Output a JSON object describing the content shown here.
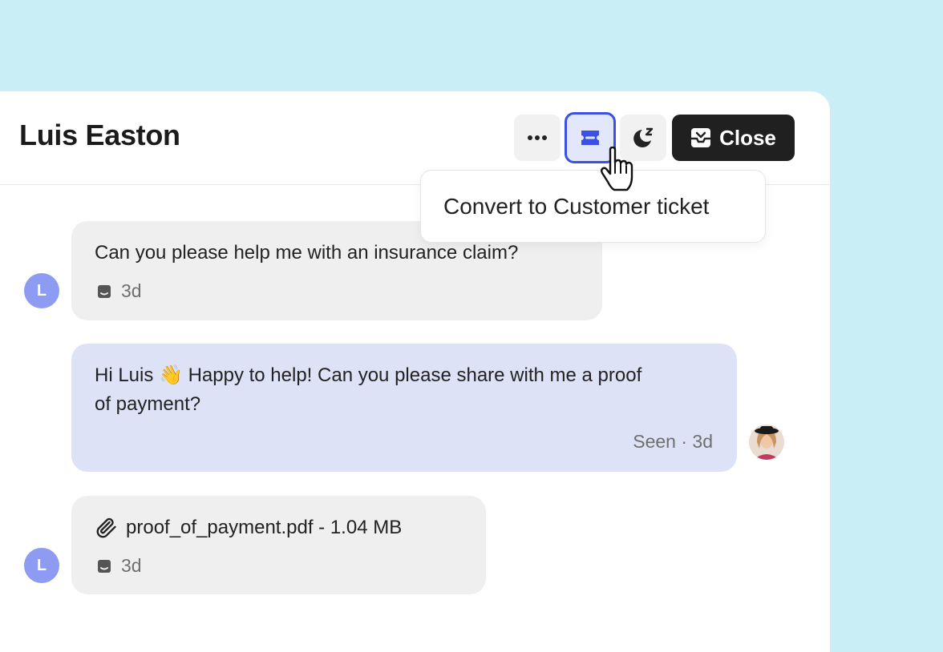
{
  "conversation": {
    "contact_name": "Luis Easton",
    "customer_initial": "L"
  },
  "toolbar": {
    "close_label": "Close",
    "convert_tooltip": "Convert to Customer ticket"
  },
  "messages": [
    {
      "text": "Can you please help me with an insurance claim?",
      "time": "3d"
    },
    {
      "text_line1": "Hi Luis 👋 Happy to help! Can you please share with me a proof",
      "text_line2": "of payment?",
      "status": "Seen · 3d"
    },
    {
      "attachment": "proof_of_payment.pdf - 1.04 MB",
      "time": "3d"
    }
  ],
  "icons": [
    "more-icon",
    "ticket-icon",
    "snooze-icon",
    "close-inbox-icon",
    "hand-cursor-icon",
    "inbox-channel-icon",
    "paperclip-icon"
  ]
}
